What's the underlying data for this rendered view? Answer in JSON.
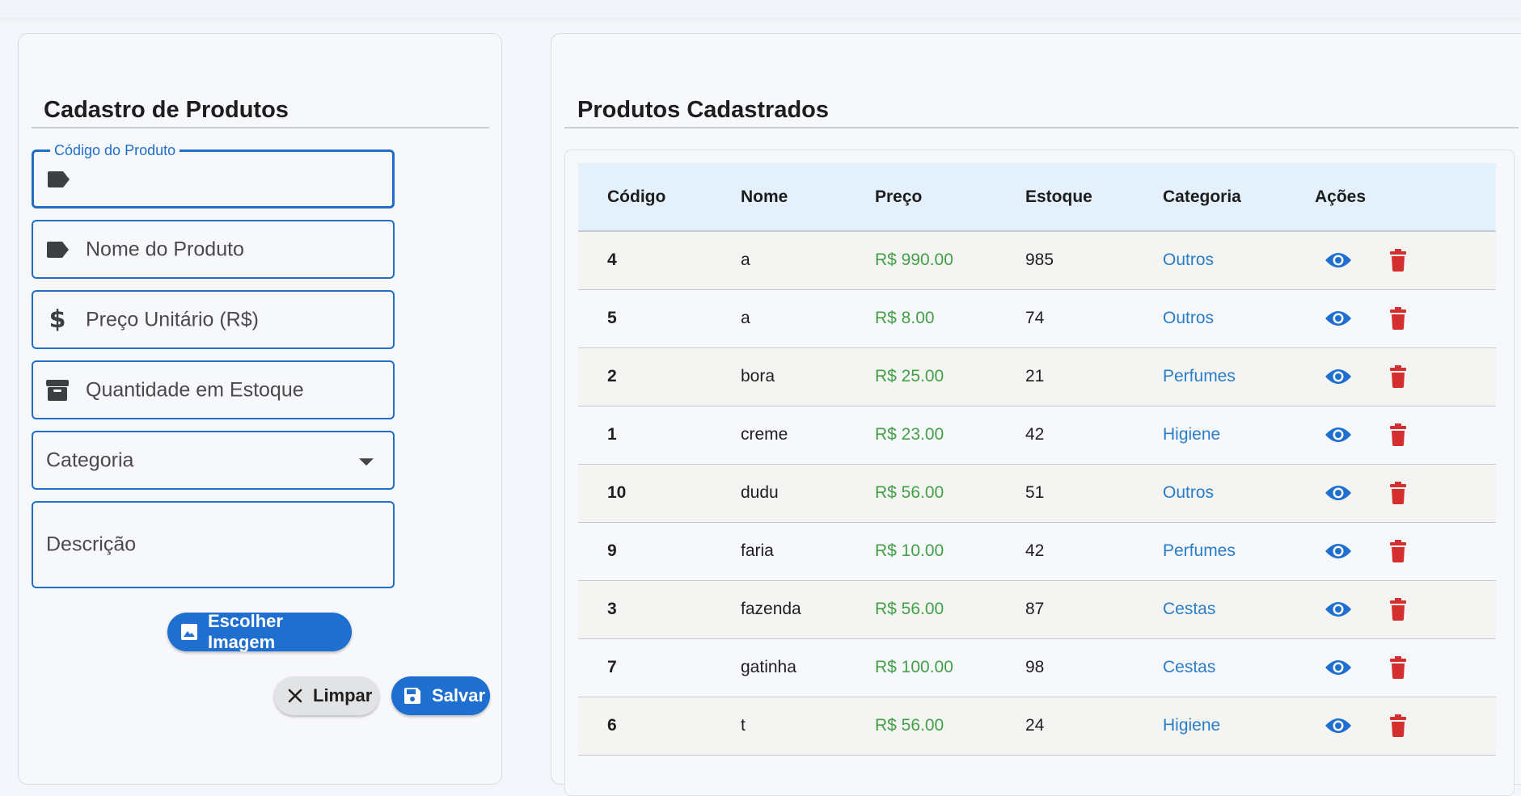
{
  "form": {
    "title": "Cadastro de Produtos",
    "fields": {
      "codigo": {
        "label": "Código do Produto",
        "value": ""
      },
      "nome": {
        "placeholder": "Nome do Produto"
      },
      "preco": {
        "placeholder": "Preço Unitário (R$)"
      },
      "estoque": {
        "placeholder": "Quantidade em Estoque"
      },
      "categoria": {
        "placeholder": "Categoria"
      },
      "descricao": {
        "placeholder": "Descrição"
      }
    },
    "image_button": "Escolher Imagem",
    "clear_button": "Limpar",
    "save_button": "Salvar"
  },
  "list": {
    "title": "Produtos Cadastrados",
    "columns": [
      "Código",
      "Nome",
      "Preço",
      "Estoque",
      "Categoria",
      "Ações"
    ],
    "rows": [
      {
        "codigo": "4",
        "nome": "a",
        "preco": "R$ 990.00",
        "estoque": "985",
        "categoria": "Outros"
      },
      {
        "codigo": "5",
        "nome": "a",
        "preco": "R$ 8.00",
        "estoque": "74",
        "categoria": "Outros"
      },
      {
        "codigo": "2",
        "nome": "bora",
        "preco": "R$ 25.00",
        "estoque": "21",
        "categoria": "Perfumes"
      },
      {
        "codigo": "1",
        "nome": "creme",
        "preco": "R$ 23.00",
        "estoque": "42",
        "categoria": "Higiene"
      },
      {
        "codigo": "10",
        "nome": "dudu",
        "preco": "R$ 56.00",
        "estoque": "51",
        "categoria": "Outros"
      },
      {
        "codigo": "9",
        "nome": "faria",
        "preco": "R$ 10.00",
        "estoque": "42",
        "categoria": "Perfumes"
      },
      {
        "codigo": "3",
        "nome": "fazenda",
        "preco": "R$ 56.00",
        "estoque": "87",
        "categoria": "Cestas"
      },
      {
        "codigo": "7",
        "nome": "gatinha",
        "preco": "R$ 100.00",
        "estoque": "98",
        "categoria": "Cestas"
      },
      {
        "codigo": "6",
        "nome": "t",
        "preco": "R$ 56.00",
        "estoque": "24",
        "categoria": "Higiene"
      }
    ],
    "action_icons": [
      "eye-icon",
      "trash-icon"
    ]
  },
  "colors": {
    "primary": "#1f6fd0",
    "price": "#43a047",
    "category": "#2a7dc8",
    "delete": "#d32f2f",
    "header_bg": "#e4f1fc"
  }
}
